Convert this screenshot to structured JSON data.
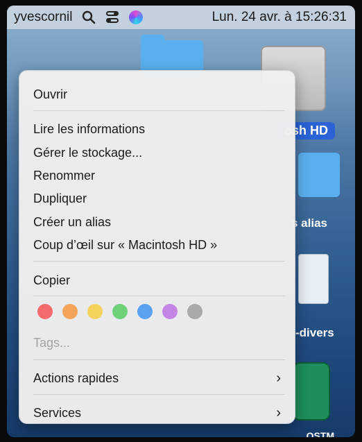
{
  "menubar": {
    "user": "yvescornil",
    "clock": "Lun. 24 avr. à 15:26:31",
    "icons": [
      "search-icon",
      "control-center-icon",
      "siri-icon"
    ]
  },
  "desktop": {
    "hd_label": "osh HD",
    "alias_label": "s alias",
    "divers_label": "-divers",
    "bottom_label": "...OSTM"
  },
  "context_menu": {
    "open": "Ouvrir",
    "get_info": "Lire les informations",
    "manage_storage": "Gérer le stockage...",
    "rename": "Renommer",
    "duplicate": "Dupliquer",
    "make_alias": "Créer un alias",
    "quick_look": "Coup d’œil sur « Macintosh HD »",
    "copy": "Copier",
    "tag_colors": [
      "#f36b6b",
      "#f4a35a",
      "#f3d35c",
      "#6fd07a",
      "#5aa2ef",
      "#c486e5",
      "#a9a9a9"
    ],
    "tags_placeholder": "Tags...",
    "quick_actions": "Actions rapides",
    "services": "Services"
  }
}
